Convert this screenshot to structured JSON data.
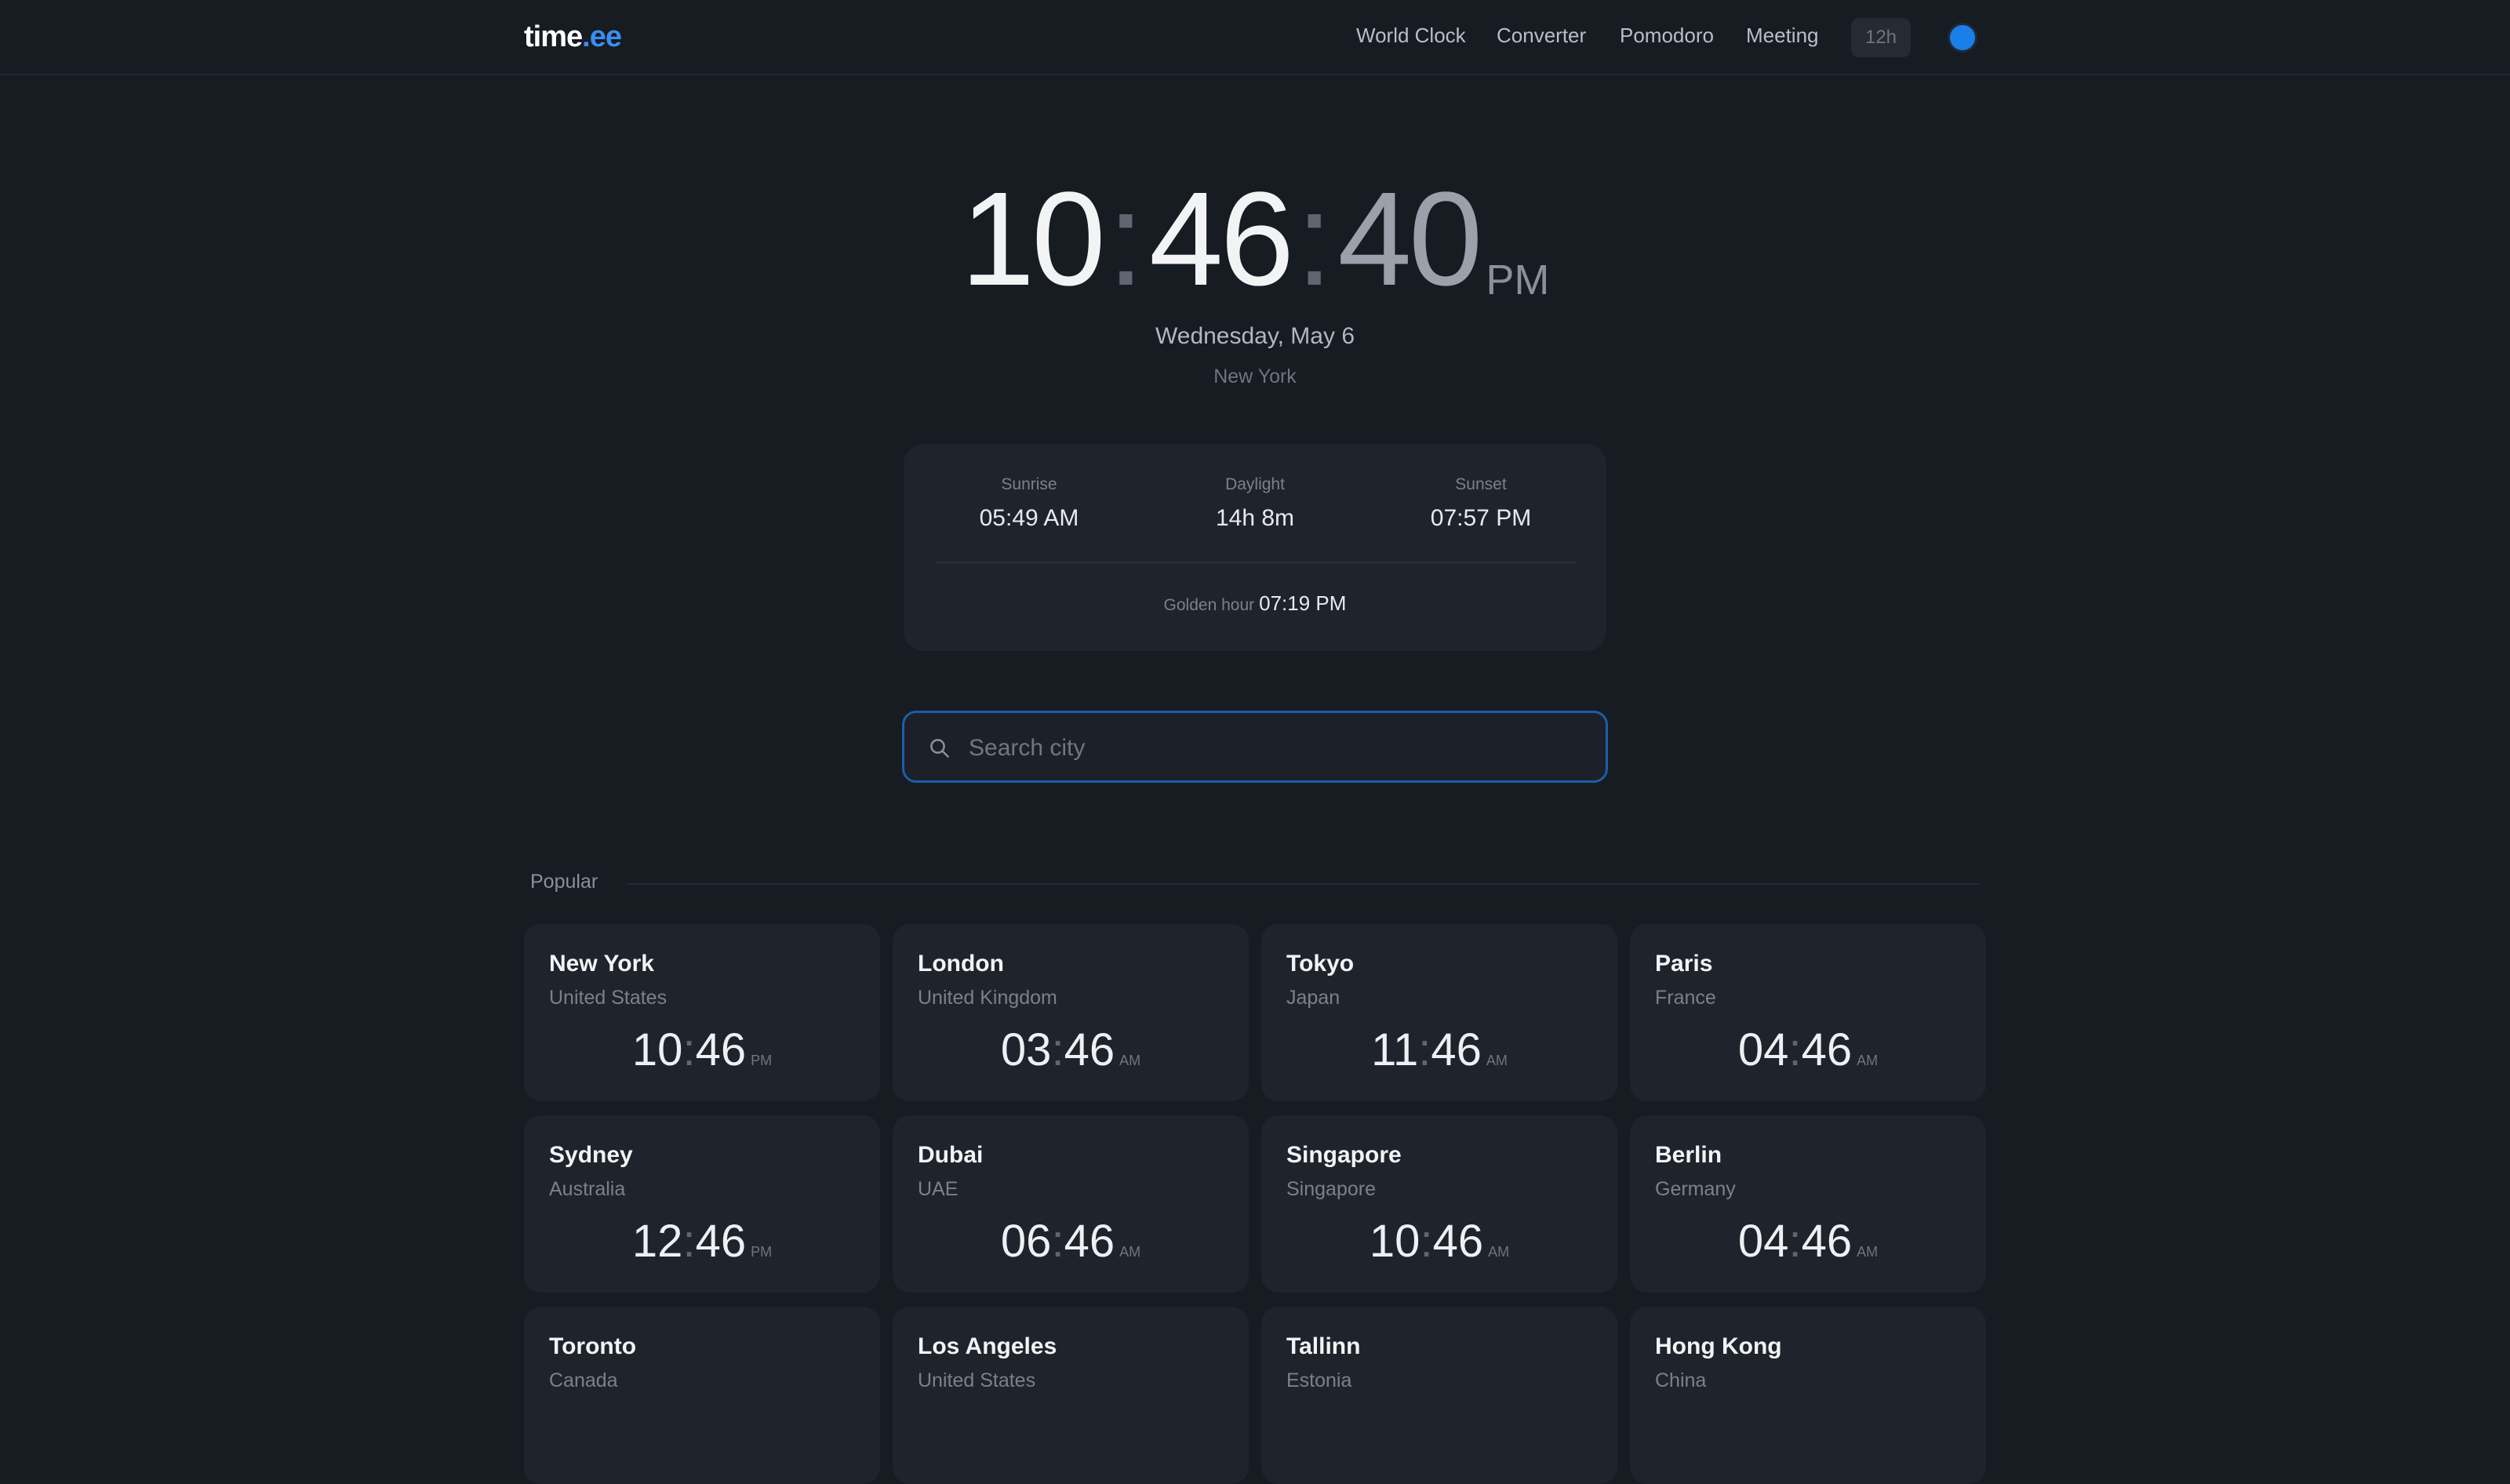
{
  "header": {
    "logo_main": "time",
    "logo_tld": ".ee",
    "nav": [
      "World Clock",
      "Converter",
      "Pomodoro",
      "Meeting"
    ],
    "format_toggle": "12h",
    "theme_color": "#1a7fe8"
  },
  "clock": {
    "hours": "10",
    "minutes": "46",
    "seconds": "40",
    "ampm": "PM",
    "date": "Wednesday, May 6",
    "city": "New York"
  },
  "sun": {
    "sunrise_label": "Sunrise",
    "sunrise": "05:49 AM",
    "daylight_label": "Daylight",
    "daylight": "14h 8m",
    "sunset_label": "Sunset",
    "sunset": "07:57 PM",
    "golden_label": "Golden hour",
    "golden": "07:19 PM"
  },
  "search": {
    "placeholder": "Search city"
  },
  "popular": {
    "title": "Popular",
    "cities": [
      {
        "name": "New York",
        "country": "United States",
        "hh": "10",
        "mm": "46",
        "ampm": "PM"
      },
      {
        "name": "London",
        "country": "United Kingdom",
        "hh": "03",
        "mm": "46",
        "ampm": "AM"
      },
      {
        "name": "Tokyo",
        "country": "Japan",
        "hh": "11",
        "mm": "46",
        "ampm": "AM"
      },
      {
        "name": "Paris",
        "country": "France",
        "hh": "04",
        "mm": "46",
        "ampm": "AM"
      },
      {
        "name": "Sydney",
        "country": "Australia",
        "hh": "12",
        "mm": "46",
        "ampm": "PM"
      },
      {
        "name": "Dubai",
        "country": "UAE",
        "hh": "06",
        "mm": "46",
        "ampm": "AM"
      },
      {
        "name": "Singapore",
        "country": "Singapore",
        "hh": "10",
        "mm": "46",
        "ampm": "AM"
      },
      {
        "name": "Berlin",
        "country": "Germany",
        "hh": "04",
        "mm": "46",
        "ampm": "AM"
      },
      {
        "name": "Toronto",
        "country": "Canada",
        "hh": "",
        "mm": "",
        "ampm": ""
      },
      {
        "name": "Los Angeles",
        "country": "United States",
        "hh": "",
        "mm": "",
        "ampm": ""
      },
      {
        "name": "Tallinn",
        "country": "Estonia",
        "hh": "",
        "mm": "",
        "ampm": ""
      },
      {
        "name": "Hong Kong",
        "country": "China",
        "hh": "",
        "mm": "",
        "ampm": ""
      }
    ]
  }
}
